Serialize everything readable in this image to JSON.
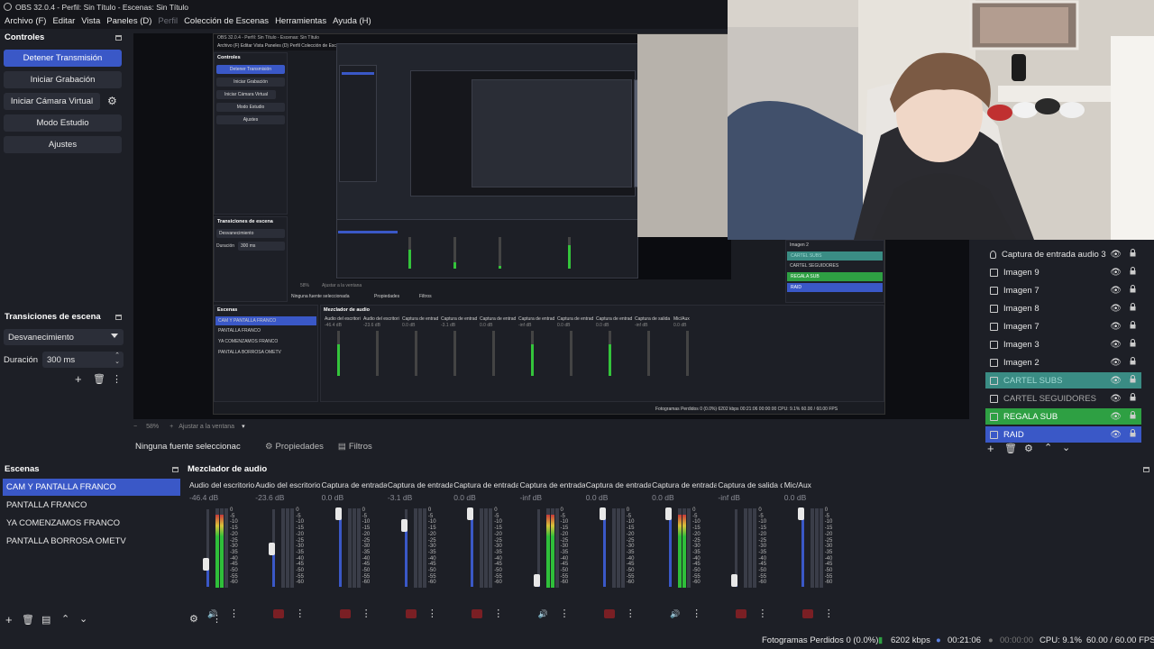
{
  "window": {
    "title": "OBS 32.0.4 - Perfil: Sin Título - Escenas: Sin Título"
  },
  "menu": [
    "Archivo (F)",
    "Editar",
    "Vista",
    "Paneles (D)",
    "Perfil",
    "Colección de Escenas",
    "Herramientas",
    "Ayuda (H)"
  ],
  "controls": {
    "title": "Controles",
    "stop_stream": "Detener Transmisión",
    "start_record": "Iniciar Grabación",
    "start_vcam": "Iniciar Cámara Virtual",
    "studio_mode": "Modo Estudio",
    "settings": "Ajustes"
  },
  "transitions": {
    "title": "Transiciones de escena",
    "selected": "Desvanecimiento",
    "duration_label": "Duración",
    "duration_value": "300 ms"
  },
  "preview": {
    "zoom": "58%",
    "fit_label": "Ajustar a la ventana",
    "nested": {
      "title": "OBS 32.0.4 - Perfil: Sin Título - Escenas: Sin Título",
      "menu": "Archivo (F)   Editar   Vista   Paneles (D)   Perfil   Colección de Escenas   Herramientas   Ayuda (H)",
      "controls_title": "Controles",
      "buttons": [
        "Detener Transmisión",
        "Iniciar Grabación",
        "Iniciar Cámara Virtual",
        "Modo Estudio",
        "Ajustes"
      ],
      "transitions_title": "Transiciones de escena",
      "transition_sel": "Desvanecimiento",
      "duration_label": "Duración",
      "duration_value": "300 ms",
      "scenes_title": "Escenas",
      "scenes": [
        "CAM Y PANTALLA FRANCO",
        "PANTALLA FRANCO",
        "YA COMENZAMOS FRANCO",
        "PANTALLA BORROSA OMETV"
      ],
      "mixer_title": "Mezclador de audio",
      "no_source": "Ninguna fuente seleccionada",
      "props": "Propiedades",
      "filters": "Filtros",
      "zoom": "58%",
      "fit": "Ajustar a la ventana",
      "sources": [
        "Imagen 2",
        "CARTEL SUBS",
        "CARTEL SEGUIDORES",
        "REGALA SUB",
        "RAID"
      ],
      "channels": [
        "Audio del escritorio",
        "Audio del escritorio",
        "Captura de entrada",
        "Captura de entrada",
        "Captura de entrada",
        "Captura de entrada",
        "Captura de entrada",
        "Captura de entrada",
        "Captura de salida",
        "Mic/Aux"
      ],
      "channel_db": [
        "-46.4 dB",
        "-23.6 dB",
        "0.0 dB",
        "-3.1 dB",
        "0.0 dB",
        "-inf dB",
        "0.0 dB",
        "0.0 dB",
        "-inf dB",
        "0.0 dB"
      ],
      "status": "Fotogramas Perdidos 0 (0.0%)   6202 kbps   00:21:06   00:00:00   CPU: 9.1%   60.00 / 60.00 FPS"
    }
  },
  "sources": [
    {
      "name": "Captura de entrada audio 3",
      "icon": "mic-icon",
      "style": "normal"
    },
    {
      "name": "Imagen 9",
      "icon": "image-icon",
      "style": "normal"
    },
    {
      "name": "Imagen 7",
      "icon": "image-icon",
      "style": "normal"
    },
    {
      "name": "Imagen 8",
      "icon": "image-icon",
      "style": "normal"
    },
    {
      "name": "Imagen 7",
      "icon": "image-icon",
      "style": "normal"
    },
    {
      "name": "Imagen 3",
      "icon": "image-icon",
      "style": "normal"
    },
    {
      "name": "Imagen 2",
      "icon": "image-icon",
      "style": "normal"
    },
    {
      "name": "CARTEL SUBS",
      "icon": "group-icon",
      "style": "teal"
    },
    {
      "name": "CARTEL SEGUIDORES",
      "icon": "group-icon",
      "style": "dimtext"
    },
    {
      "name": "REGALA SUB",
      "icon": "group-icon",
      "style": "green"
    },
    {
      "name": "RAID",
      "icon": "group-icon",
      "style": "blue"
    }
  ],
  "props_bar": {
    "no_source": "Ninguna fuente seleccionac",
    "properties": "Propiedades",
    "filters": "Filtros"
  },
  "scenes": {
    "title": "Escenas",
    "items": [
      "CAM Y PANTALLA FRANCO",
      "PANTALLA FRANCO",
      "YA COMENZAMOS FRANCO",
      "PANTALLA BORROSA OMETV"
    ],
    "active_index": 0
  },
  "mixer": {
    "title": "Mezclador de audio",
    "ticks": [
      "0",
      "-5",
      "-10",
      "-15",
      "-20",
      "-25",
      "-30",
      "-35",
      "-40",
      "-45",
      "-50",
      "-55",
      "-60"
    ],
    "channels": [
      {
        "name": "Audio del escritorio",
        "db": "-46.4 dB",
        "fader": 0.35,
        "level": 0.92,
        "muted": false,
        "peak_red": true
      },
      {
        "name": "Audio del escritorio",
        "db": "-23.6 dB",
        "fader": 0.55,
        "level": 0.0,
        "muted": true,
        "peak_red": false
      },
      {
        "name": "Captura de entrada",
        "db": "0.0 dB",
        "fader": 1.0,
        "level": 0.0,
        "muted": true,
        "peak_red": false
      },
      {
        "name": "Captura de entrada",
        "db": "-3.1 dB",
        "fader": 0.85,
        "level": 0.0,
        "muted": true,
        "peak_red": false
      },
      {
        "name": "Captura de entrada",
        "db": "0.0 dB",
        "fader": 1.0,
        "level": 0.0,
        "muted": true,
        "peak_red": false
      },
      {
        "name": "Captura de entrada",
        "db": "-inf dB",
        "fader": 0.05,
        "level": 0.92,
        "muted": false,
        "peak_red": true
      },
      {
        "name": "Captura de entrada",
        "db": "0.0 dB",
        "fader": 1.0,
        "level": 0.0,
        "muted": true,
        "peak_red": false
      },
      {
        "name": "Captura de entrada",
        "db": "0.0 dB",
        "fader": 1.0,
        "level": 0.92,
        "muted": false,
        "peak_red": true
      },
      {
        "name": "Captura de salida d",
        "db": "-inf dB",
        "fader": 0.05,
        "level": 0.0,
        "muted": true,
        "peak_red": false
      },
      {
        "name": "Mic/Aux",
        "db": "0.0 dB",
        "fader": 1.0,
        "level": 0.0,
        "muted": true,
        "peak_red": false
      }
    ]
  },
  "status": {
    "dropped": "Fotogramas Perdidos 0 (0.0%)",
    "bitrate": "6202 kbps",
    "stream_time": "00:21:06",
    "rec_time": "00:00:00",
    "cpu": "CPU: 9.1%",
    "fps": "60.00 / 60.00 FPS"
  },
  "colors": {
    "accent": "#3a58c7",
    "green": "#2ea043",
    "teal": "#3a8c84",
    "bg": "#1d1f26"
  }
}
